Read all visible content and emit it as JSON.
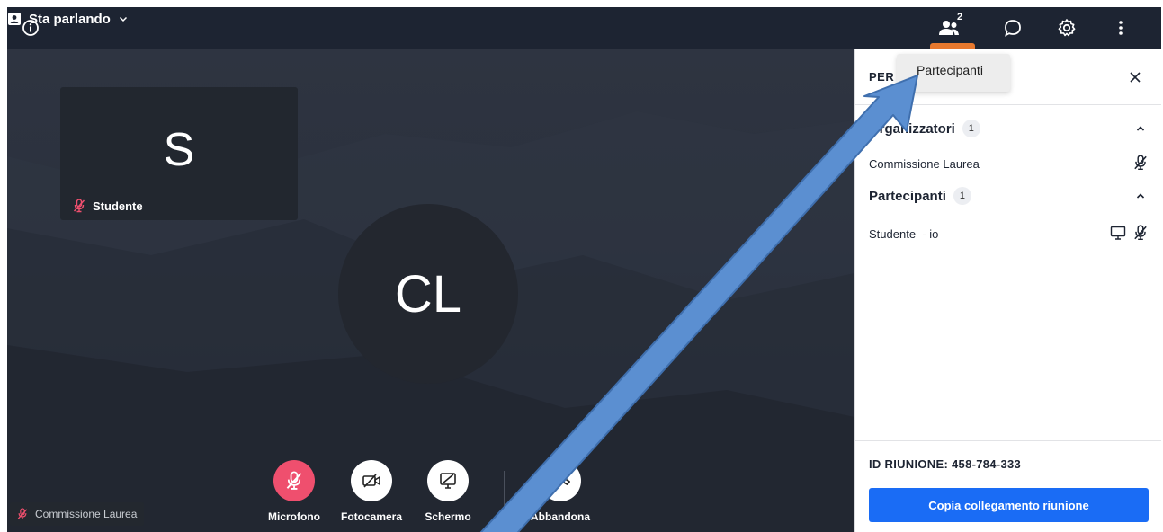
{
  "topbar": {
    "layout_label": "Sta parlando",
    "participants_count": "2",
    "icons": {
      "info": "info-icon",
      "layout": "speaker-view-icon",
      "people": "people-icon",
      "chat": "chat-icon",
      "settings": "gear-icon",
      "more": "more-vertical-icon"
    }
  },
  "stage": {
    "tile": {
      "initial": "S",
      "name": "Studente",
      "mic": "muted"
    },
    "speaker": {
      "initials": "CL"
    },
    "self_label": "Commissione Laurea"
  },
  "controls": [
    {
      "label": "Microfono",
      "icon": "mic-off-icon",
      "state": "muted"
    },
    {
      "label": "Fotocamera",
      "icon": "camera-off-icon"
    },
    {
      "label": "Schermo",
      "icon": "screen-share-off-icon"
    },
    {
      "label": "Abbandona",
      "icon": "hang-up-icon"
    }
  ],
  "panel": {
    "title": "PER",
    "tooltip": "Partecipanti",
    "sections": [
      {
        "title": "Organizzatori",
        "count": "1",
        "rows": [
          {
            "name": "Commissione Laurea"
          }
        ]
      },
      {
        "title": "Partecipanti",
        "count": "1",
        "rows": [
          {
            "name": "Studente  - io"
          }
        ]
      }
    ],
    "meeting_id": "ID RIUNIONE: 458-784-333",
    "copy_button": "Copia collegamento riunione"
  },
  "colors": {
    "topbar": "#1d2432",
    "accent_orange": "#e8792e",
    "mic_muted": "#ef4f6e",
    "primary_button": "#1a6cf5",
    "annotation_arrow": "#5b8fd1"
  }
}
